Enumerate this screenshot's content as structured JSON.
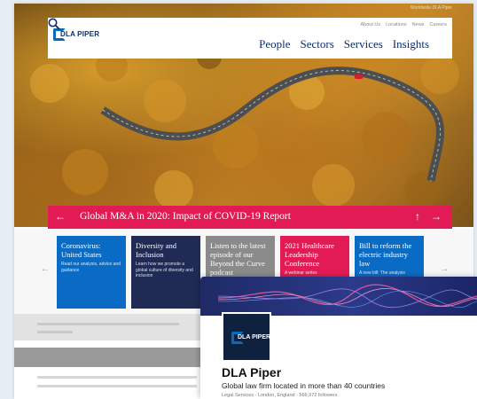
{
  "site": {
    "utility_links": [
      "About Us",
      "Locations",
      "News",
      "Careers"
    ],
    "utility_top": "Worldwide  DLA Piper",
    "logo_text": "DLA PIPER",
    "nav": [
      "People",
      "Sectors",
      "Services",
      "Insights"
    ],
    "banner_title": "Global M&A in 2020: Impact of COVID-19 Report",
    "tiles": [
      {
        "title": "Coronavirus: United States",
        "desc": "Read our analysis, advice and guidance",
        "color": "#0a6bc4"
      },
      {
        "title": "Diversity and Inclusion",
        "desc": "Learn how we promote a global culture of diversity and inclusion",
        "color": "#1f2a55"
      },
      {
        "title": "Listen to the latest episode of our Beyond the Curve podcast",
        "desc": "",
        "color": "#8a8a8a"
      },
      {
        "title": "2021 Healthcare Leadership Conference",
        "desc": "A webinar series",
        "color": "#e31b54"
      },
      {
        "title": "Bill to reform the electric industry law",
        "desc": "A new bill: The analysis",
        "color": "#0a6bc4"
      }
    ]
  },
  "linkedin": {
    "logo_text": "DLA PIPER",
    "name": "DLA Piper",
    "tagline": "Global law firm located in more than 40 countries",
    "meta": "Legal Services · London, England · 566,972 followers"
  }
}
